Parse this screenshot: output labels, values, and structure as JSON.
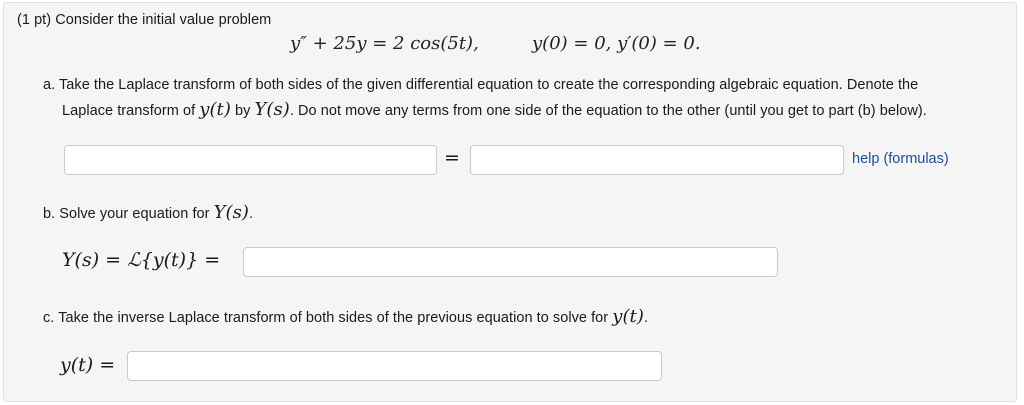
{
  "problem": {
    "points_prefix": "(1 pt) Consider the initial value problem",
    "equation": "y″ + 25y = 2 cos(5t),",
    "initial_conditions": "y(0) = 0,   y′(0) = 0."
  },
  "part_a": {
    "line1": "a. Take the Laplace transform of both sides of the given differential equation to create the corresponding algebraic equation. Denote the",
    "line2_pre": "Laplace transform of ",
    "line2_y": "y(t)",
    "line2_mid": " by ",
    "line2_Y": "Y(s)",
    "line2_post": ". Do not move any terms from one side of the equation to the other (until you get to part (b) below).",
    "left_value": "",
    "right_value": "",
    "equals": "=",
    "help_link": "help (formulas)"
  },
  "part_b": {
    "prompt_pre": "b. Solve your equation for ",
    "prompt_var": "Y(s)",
    "prompt_post": ".",
    "label": "Y(s) = ℒ{y(t)} =",
    "value": ""
  },
  "part_c": {
    "prompt_pre": "c. Take the inverse Laplace transform of both sides of the previous equation to solve for ",
    "prompt_var": "y(t)",
    "prompt_post": ".",
    "label": "y(t) =",
    "value": ""
  }
}
